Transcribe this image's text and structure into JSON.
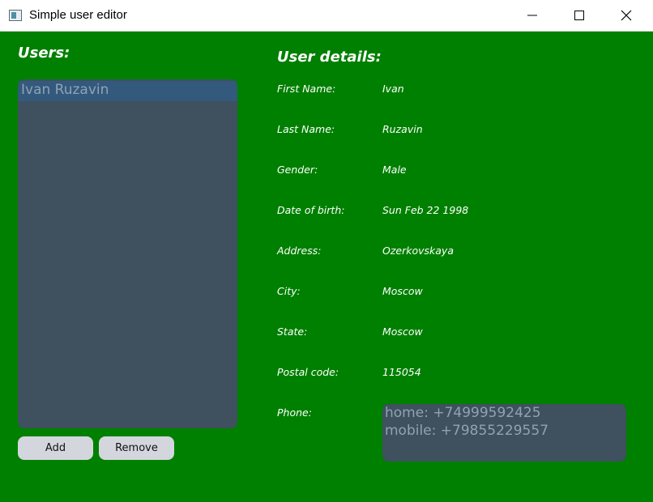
{
  "window": {
    "title": "Simple user editor",
    "icon": "app-window-icon"
  },
  "users_panel": {
    "title": "Users:",
    "users": [
      "Ivan Ruzavin"
    ],
    "add_label": "Add",
    "remove_label": "Remove"
  },
  "details_panel": {
    "title": "User details:",
    "fields": [
      {
        "label": "First Name:",
        "value": "Ivan"
      },
      {
        "label": "Last Name:",
        "value": "Ruzavin"
      },
      {
        "label": "Gender:",
        "value": "Male"
      },
      {
        "label": "Date of birth:",
        "value": "Sun Feb 22 1998"
      },
      {
        "label": "Address:",
        "value": "Ozerkovskaya"
      },
      {
        "label": "City:",
        "value": "Moscow"
      },
      {
        "label": "State:",
        "value": "Moscow"
      },
      {
        "label": "Postal code:",
        "value": "115054"
      }
    ],
    "phone_label": "Phone:",
    "phones": [
      "home: +74999592425",
      "mobile: +79855229557"
    ]
  },
  "colors": {
    "background": "#008000",
    "panel": "#3f505e",
    "selected_item": "#33597d",
    "button": "#d4d6dd"
  }
}
